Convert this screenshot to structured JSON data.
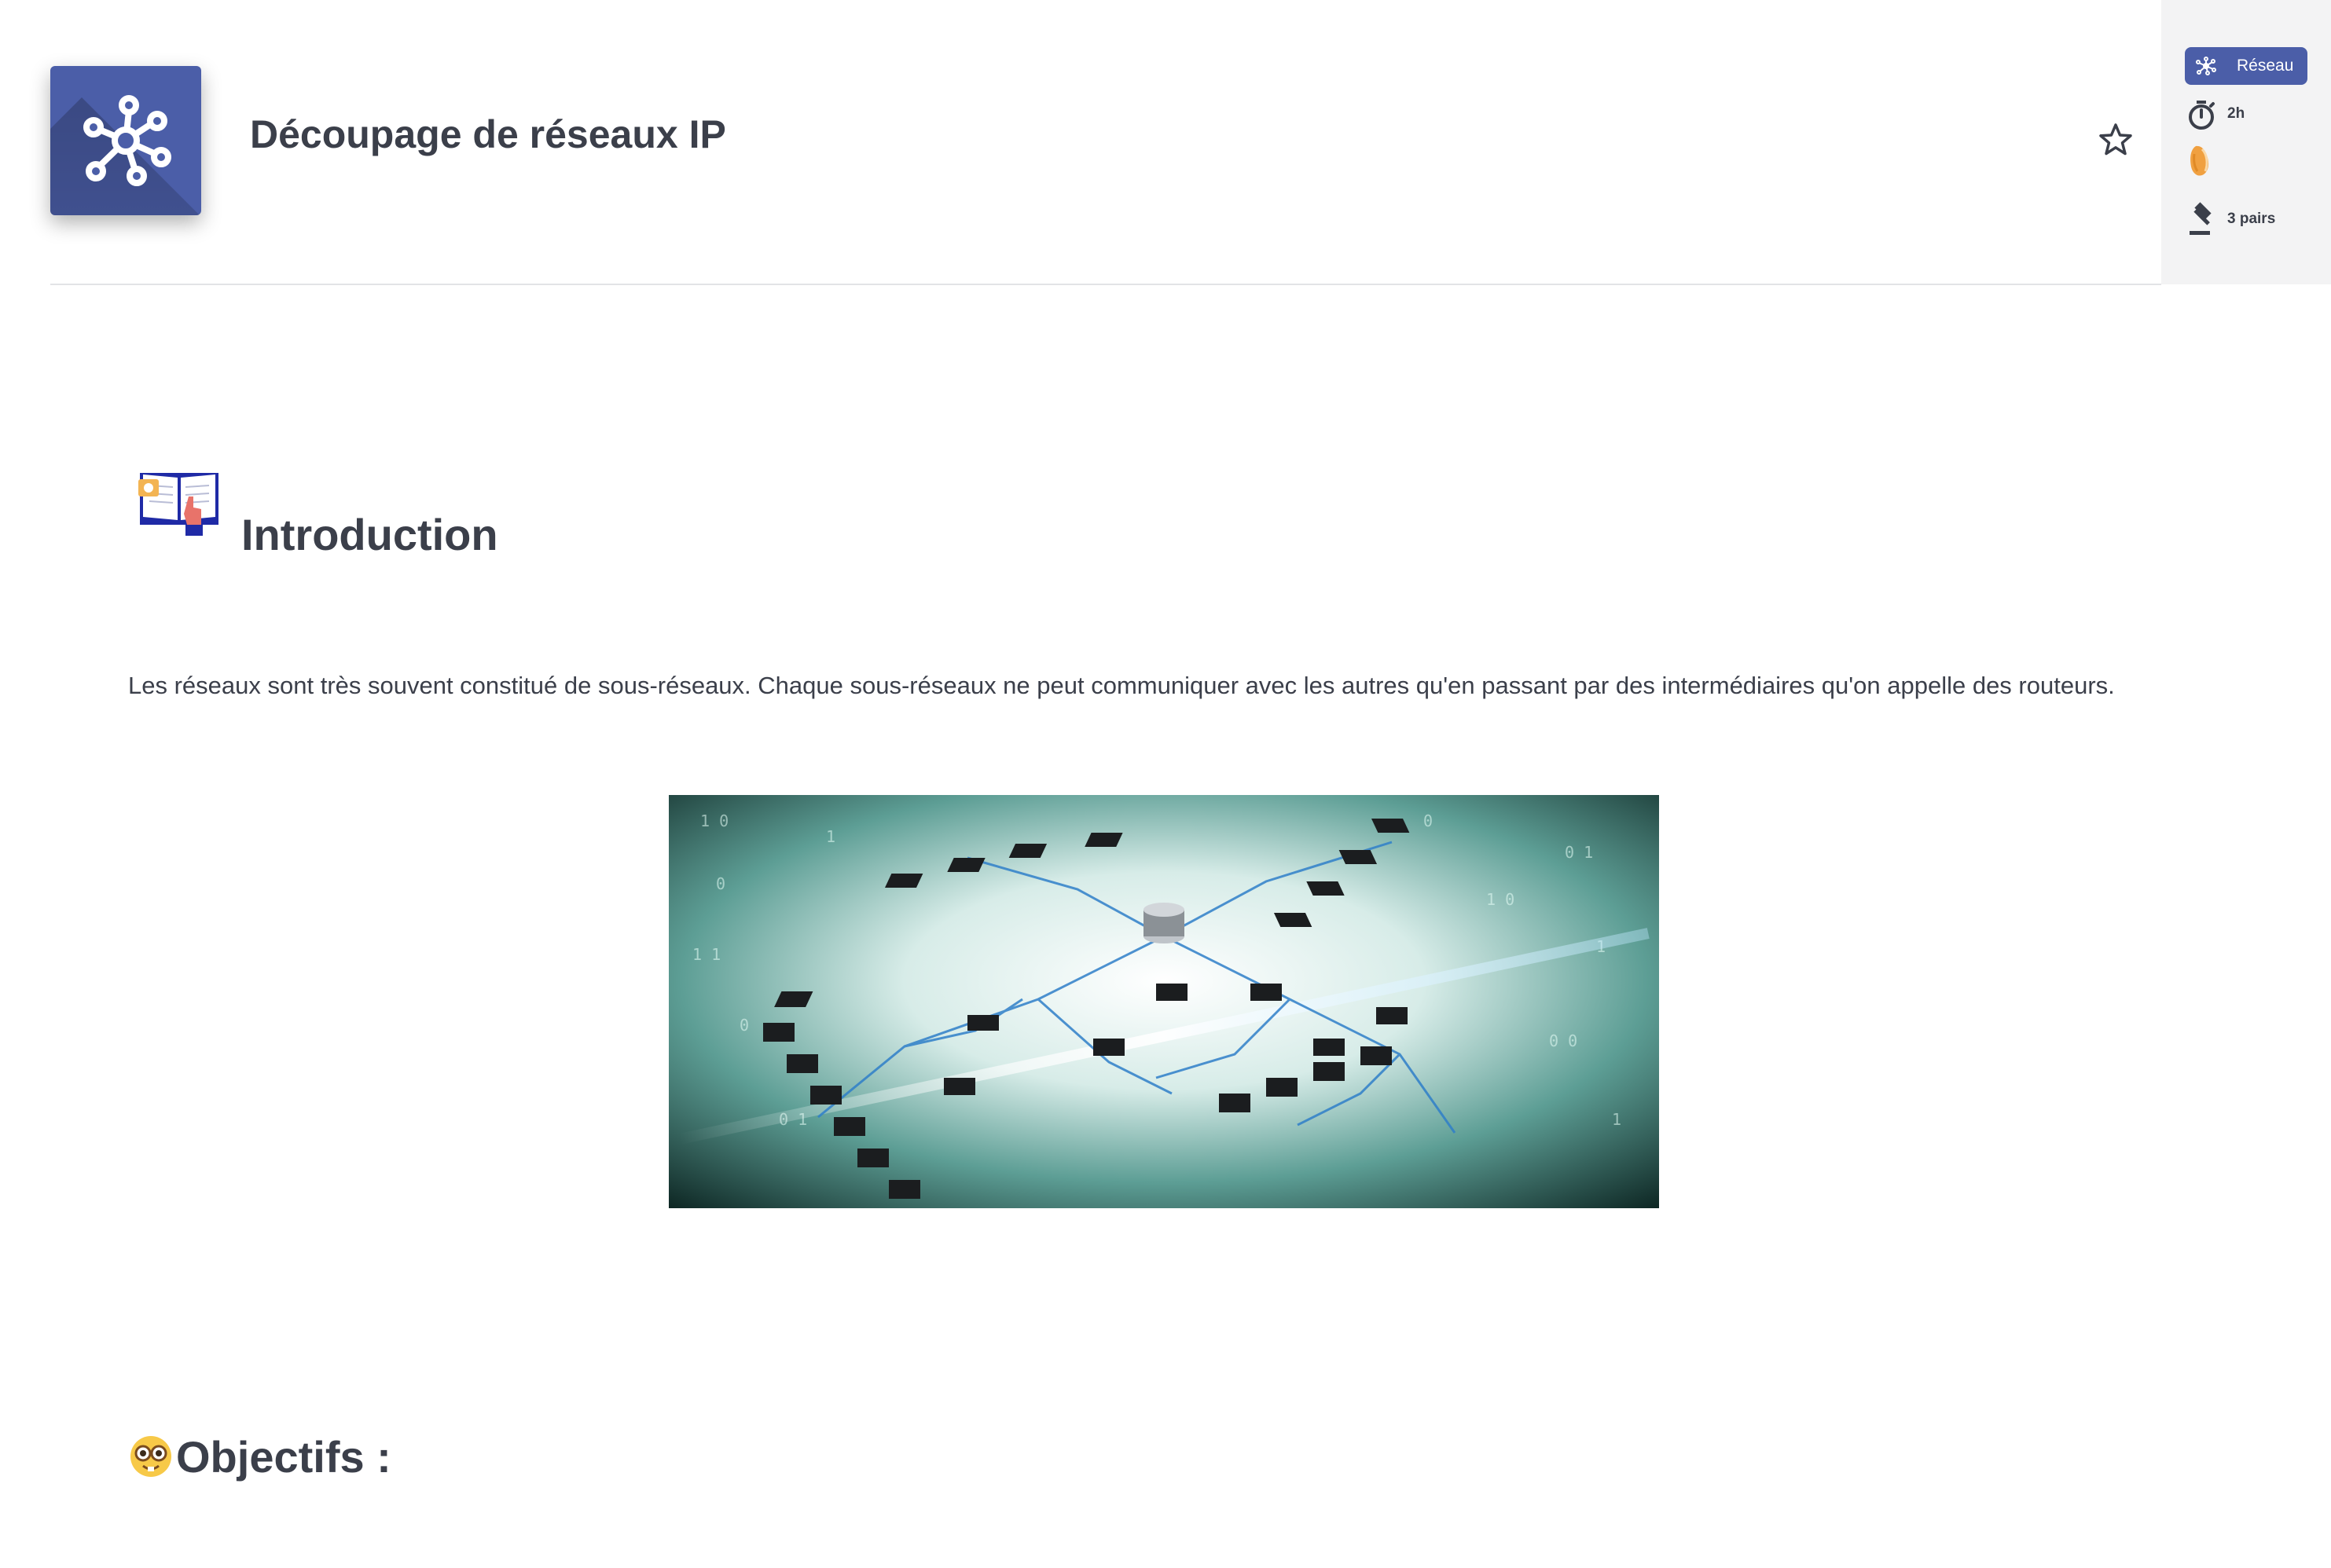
{
  "header": {
    "title": "Découpage de réseaux IP",
    "project_icon": "network-hub-icon",
    "favorite_icon": "star-outline-icon"
  },
  "info_panel": {
    "tag_label": "Réseau",
    "tag_icon": "network-icon",
    "duration": "2h",
    "duration_icon": "stopwatch-icon",
    "level_icon": "level-blob-icon",
    "peers": "3 pairs",
    "peers_icon": "gavel-icon"
  },
  "content": {
    "intro_heading": "Introduction",
    "intro_icon": "open-book-pointer-icon",
    "intro_paragraph": "Les réseaux sont très souvent constitué de sous-réseaux. Chaque sous-réseaux ne peut communiquer avec les autres qu'en passant par des intermédiaires qu'on appelle des routeurs.",
    "figure_image": "network-topology-illustration",
    "objectives_heading": "Objectifs :",
    "objectives_emoji": "nerd-face-emoji"
  },
  "colors": {
    "brand": "#4b5ea8",
    "text": "#3b3f4a",
    "panel_bg": "#f3f3f4",
    "level_orange": "#f0a040"
  }
}
